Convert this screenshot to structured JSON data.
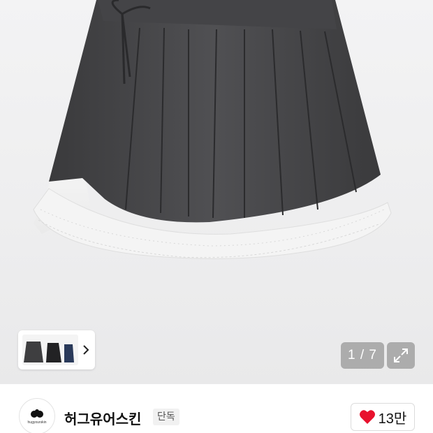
{
  "gallery": {
    "current_page": "1",
    "total_pages": "7",
    "page_separator": " / ",
    "expand_icon": "expand-arrows-icon",
    "thumbnail_next_icon": "chevron-right-icon"
  },
  "store": {
    "logo_text": "hugyourskin",
    "name": "허그유어스킨",
    "badge": "단독",
    "like_icon": "heart-icon",
    "like_count": "13만",
    "like_color": "#e8112d"
  }
}
